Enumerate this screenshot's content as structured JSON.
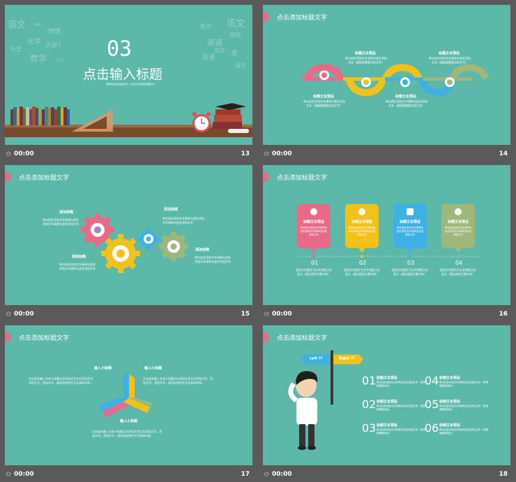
{
  "colors": {
    "bg": "#5cb8a9",
    "pink": "#e96a88",
    "yellow": "#f2c21b",
    "blue": "#3fb0e3",
    "green": "#9db87a"
  },
  "bars": [
    {
      "dur": "00:00",
      "num": "13"
    },
    {
      "dur": "00:00",
      "num": "14"
    },
    {
      "dur": "00:00",
      "num": "15"
    },
    {
      "dur": "00:00",
      "num": "16"
    },
    {
      "dur": "00:00",
      "num": "17"
    },
    {
      "dur": "00:00",
      "num": "18"
    }
  ],
  "slide13": {
    "number": "03",
    "title": "点击输入标题",
    "subtitle": "请单击此处添加文字，点击文字添加标题文本",
    "words": [
      "语文",
      "ABC",
      "物理",
      "化学",
      "历史？",
      "数学",
      "123",
      "英语",
      "数学",
      "语文",
      "物理",
      "化学",
      "历史",
      "数学",
      "英语",
      "语文",
      "壹"
    ]
  },
  "slide14": {
    "header": "点击添加标题文字",
    "items": [
      {
        "title": "标题文本预设",
        "desc": "单击此处添加文本请单击此处添加文本（请根据需要添加文字）"
      },
      {
        "title": "标题文本预设",
        "desc": "单击此处添加文本请单击此处添加文本（请根据需要添加文字）"
      },
      {
        "title": "标题文本预设",
        "desc": "单击此处添加文本请单击此处添加文本（请根据需要添加文字）"
      },
      {
        "title": "标题文本预设",
        "desc": "单击此处添加文本请单击此处添加文本（请根据需要添加文字）"
      }
    ]
  },
  "slide15": {
    "header": "点击添加标题文字",
    "labels": [
      "添加标题",
      "添加标题",
      "添加标题",
      "添加标题"
    ],
    "desc": "单击此处添加文本请单击此处添加文本请单击此处添加文本"
  },
  "slide16": {
    "header": "点击添加标题文字",
    "cards": [
      {
        "title": "标题文本预设",
        "desc": "单击此处添加文本请单击此处添加文本请单击此处添加文本"
      },
      {
        "title": "标题文本预设",
        "desc": "单击此处添加文本请单击此处添加文本请单击此处添加文本"
      },
      {
        "title": "标题文本预设",
        "desc": "单击此处添加文本请单击此处添加文本请单击此处添加文本"
      },
      {
        "title": "标题文本预设",
        "desc": "单击此处添加文本请单击此处添加文本请单击此处添加文本"
      }
    ],
    "nums": [
      "01",
      "02",
      "03",
      "04"
    ],
    "foot": "此部分内容作为文字排版占位显示（建议使用主题字体）"
  },
  "slide17": {
    "header": "点击添加标题文字",
    "labels": [
      "输入小标题",
      "输入小标题",
      "输入小标题"
    ],
    "desc": "点击此处输入文本小标题点击添加文字点击添加文字，添加文字。添加文字，请添加说明文字及具体内容。"
  },
  "slide18": {
    "header": "点击添加标题文字",
    "left": "Left ??",
    "right": "Right ??",
    "items": [
      {
        "n": "01",
        "t": "标题文本预设",
        "d": "单击此处添加文本请单击此处添加文本（请根据需要添加）"
      },
      {
        "n": "02",
        "t": "标题文本预设",
        "d": "单击此处添加文本请单击此处添加文本（请根据需要添加）"
      },
      {
        "n": "03",
        "t": "标题文本预设",
        "d": "单击此处添加文本请单击此处添加文本（请根据需要添加）"
      },
      {
        "n": "04",
        "t": "标题文本预设",
        "d": "单击此处添加文本请单击此处添加文本（请根据需要添加）"
      },
      {
        "n": "05",
        "t": "标题文本预设",
        "d": "单击此处添加文本请单击此处添加文本（请根据需要添加）"
      },
      {
        "n": "06",
        "t": "标题文本预设",
        "d": "单击此处添加文本请单击此处添加文本（请根据需要添加）"
      }
    ]
  }
}
